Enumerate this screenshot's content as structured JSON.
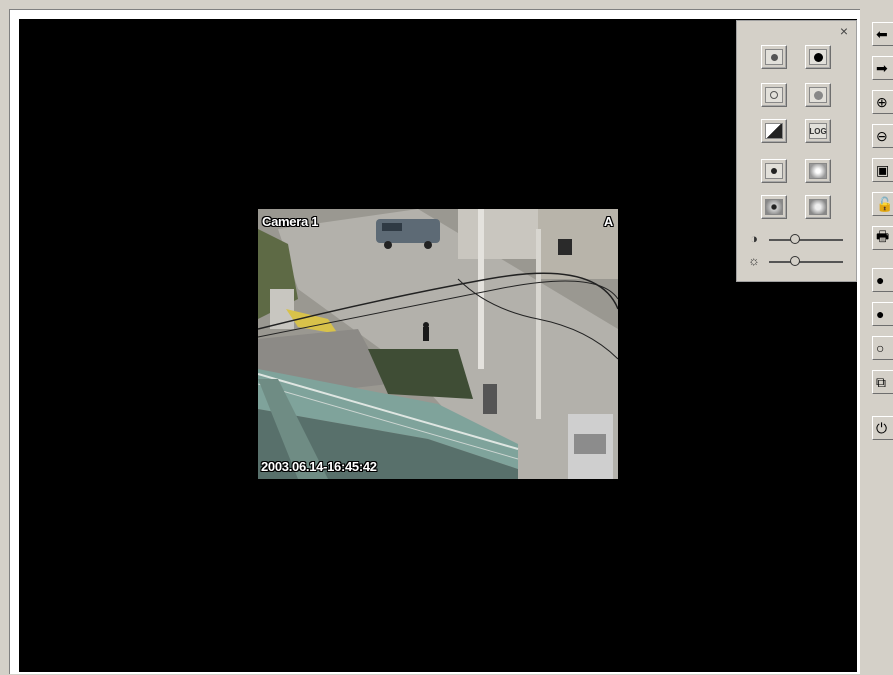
{
  "video": {
    "camera_name": "Camera 1",
    "channel_tag": "A",
    "timestamp": "2003.06.14-16:45:42"
  },
  "control_panel": {
    "close_label": "×",
    "log_label": "LOG",
    "contrast_symbol": "◑",
    "brightness_symbol": "☼",
    "contrast_level": 0.35,
    "brightness_level": 0.35
  },
  "toolbar": {
    "items": [
      {
        "icon": "arrow-left-icon",
        "glyph": "⬅"
      },
      {
        "icon": "arrow-right-icon",
        "glyph": "➡"
      },
      {
        "icon": "zoom-in-icon",
        "glyph": "⊕"
      },
      {
        "icon": "zoom-out-icon",
        "glyph": "⊖"
      },
      {
        "icon": "monitor-icon",
        "glyph": "▣"
      },
      {
        "icon": "unlock-icon",
        "glyph": "🔓"
      },
      {
        "icon": "print-icon",
        "glyph": "🖶"
      },
      {
        "icon": "record-dot-icon",
        "glyph": "●"
      },
      {
        "icon": "record-icon",
        "glyph": "●"
      },
      {
        "icon": "circle-icon",
        "glyph": "○"
      },
      {
        "icon": "copy-icon",
        "glyph": "⧉"
      },
      {
        "icon": "power-icon",
        "glyph": "⏻"
      }
    ]
  }
}
